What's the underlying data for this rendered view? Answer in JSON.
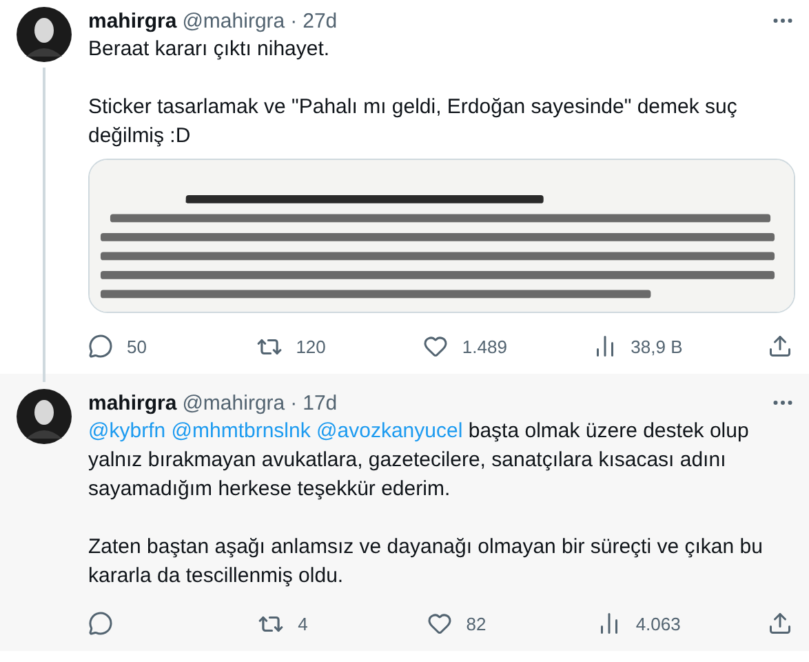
{
  "tweets": [
    {
      "name": "mahirgra",
      "handle": "@mahirgra",
      "separator": "·",
      "time": "27d",
      "highlighted": false,
      "thread_continues": true,
      "paragraphs": [
        [
          {
            "kind": "text",
            "text": "Beraat kararı çıktı nihayet."
          }
        ],
        [
          {
            "kind": "text",
            "text": "Sticker tasarlamak ve \"Pahalı mı geldi, Erdoğan sayesinde\" demek suç değilmiş :D"
          }
        ]
      ],
      "media": {
        "kind": "picture"
      },
      "stats": {
        "replies": "50",
        "retweets": "120",
        "likes": "1.489",
        "views": "38,9 B"
      }
    },
    {
      "name": "mahirgra",
      "handle": "@mahirgra",
      "separator": "·",
      "time": "17d",
      "highlighted": true,
      "paragraphs": [
        [
          {
            "kind": "mention",
            "text": "@kybrfn"
          },
          {
            "kind": "mention",
            "text": "@mhmtbrnslnk"
          },
          {
            "kind": "mention",
            "text": "@avozkanyucel"
          },
          {
            "kind": "text",
            "text": "başta olmak üzere destek olup yalnız bırakmayan avukatlara, gazetecilere, sanatçılara kısacası adını sayamadığım herkese teşekkür ederim."
          }
        ],
        [
          {
            "kind": "text",
            "text": "Zaten baştan aşağı anlamsız ve dayanağı olmayan bir süreçti ve çıkan bu kararla da tescillenmiş oldu."
          }
        ]
      ],
      "stats": {
        "retweets": "4",
        "likes": "82",
        "views": "4.063"
      }
    }
  ]
}
